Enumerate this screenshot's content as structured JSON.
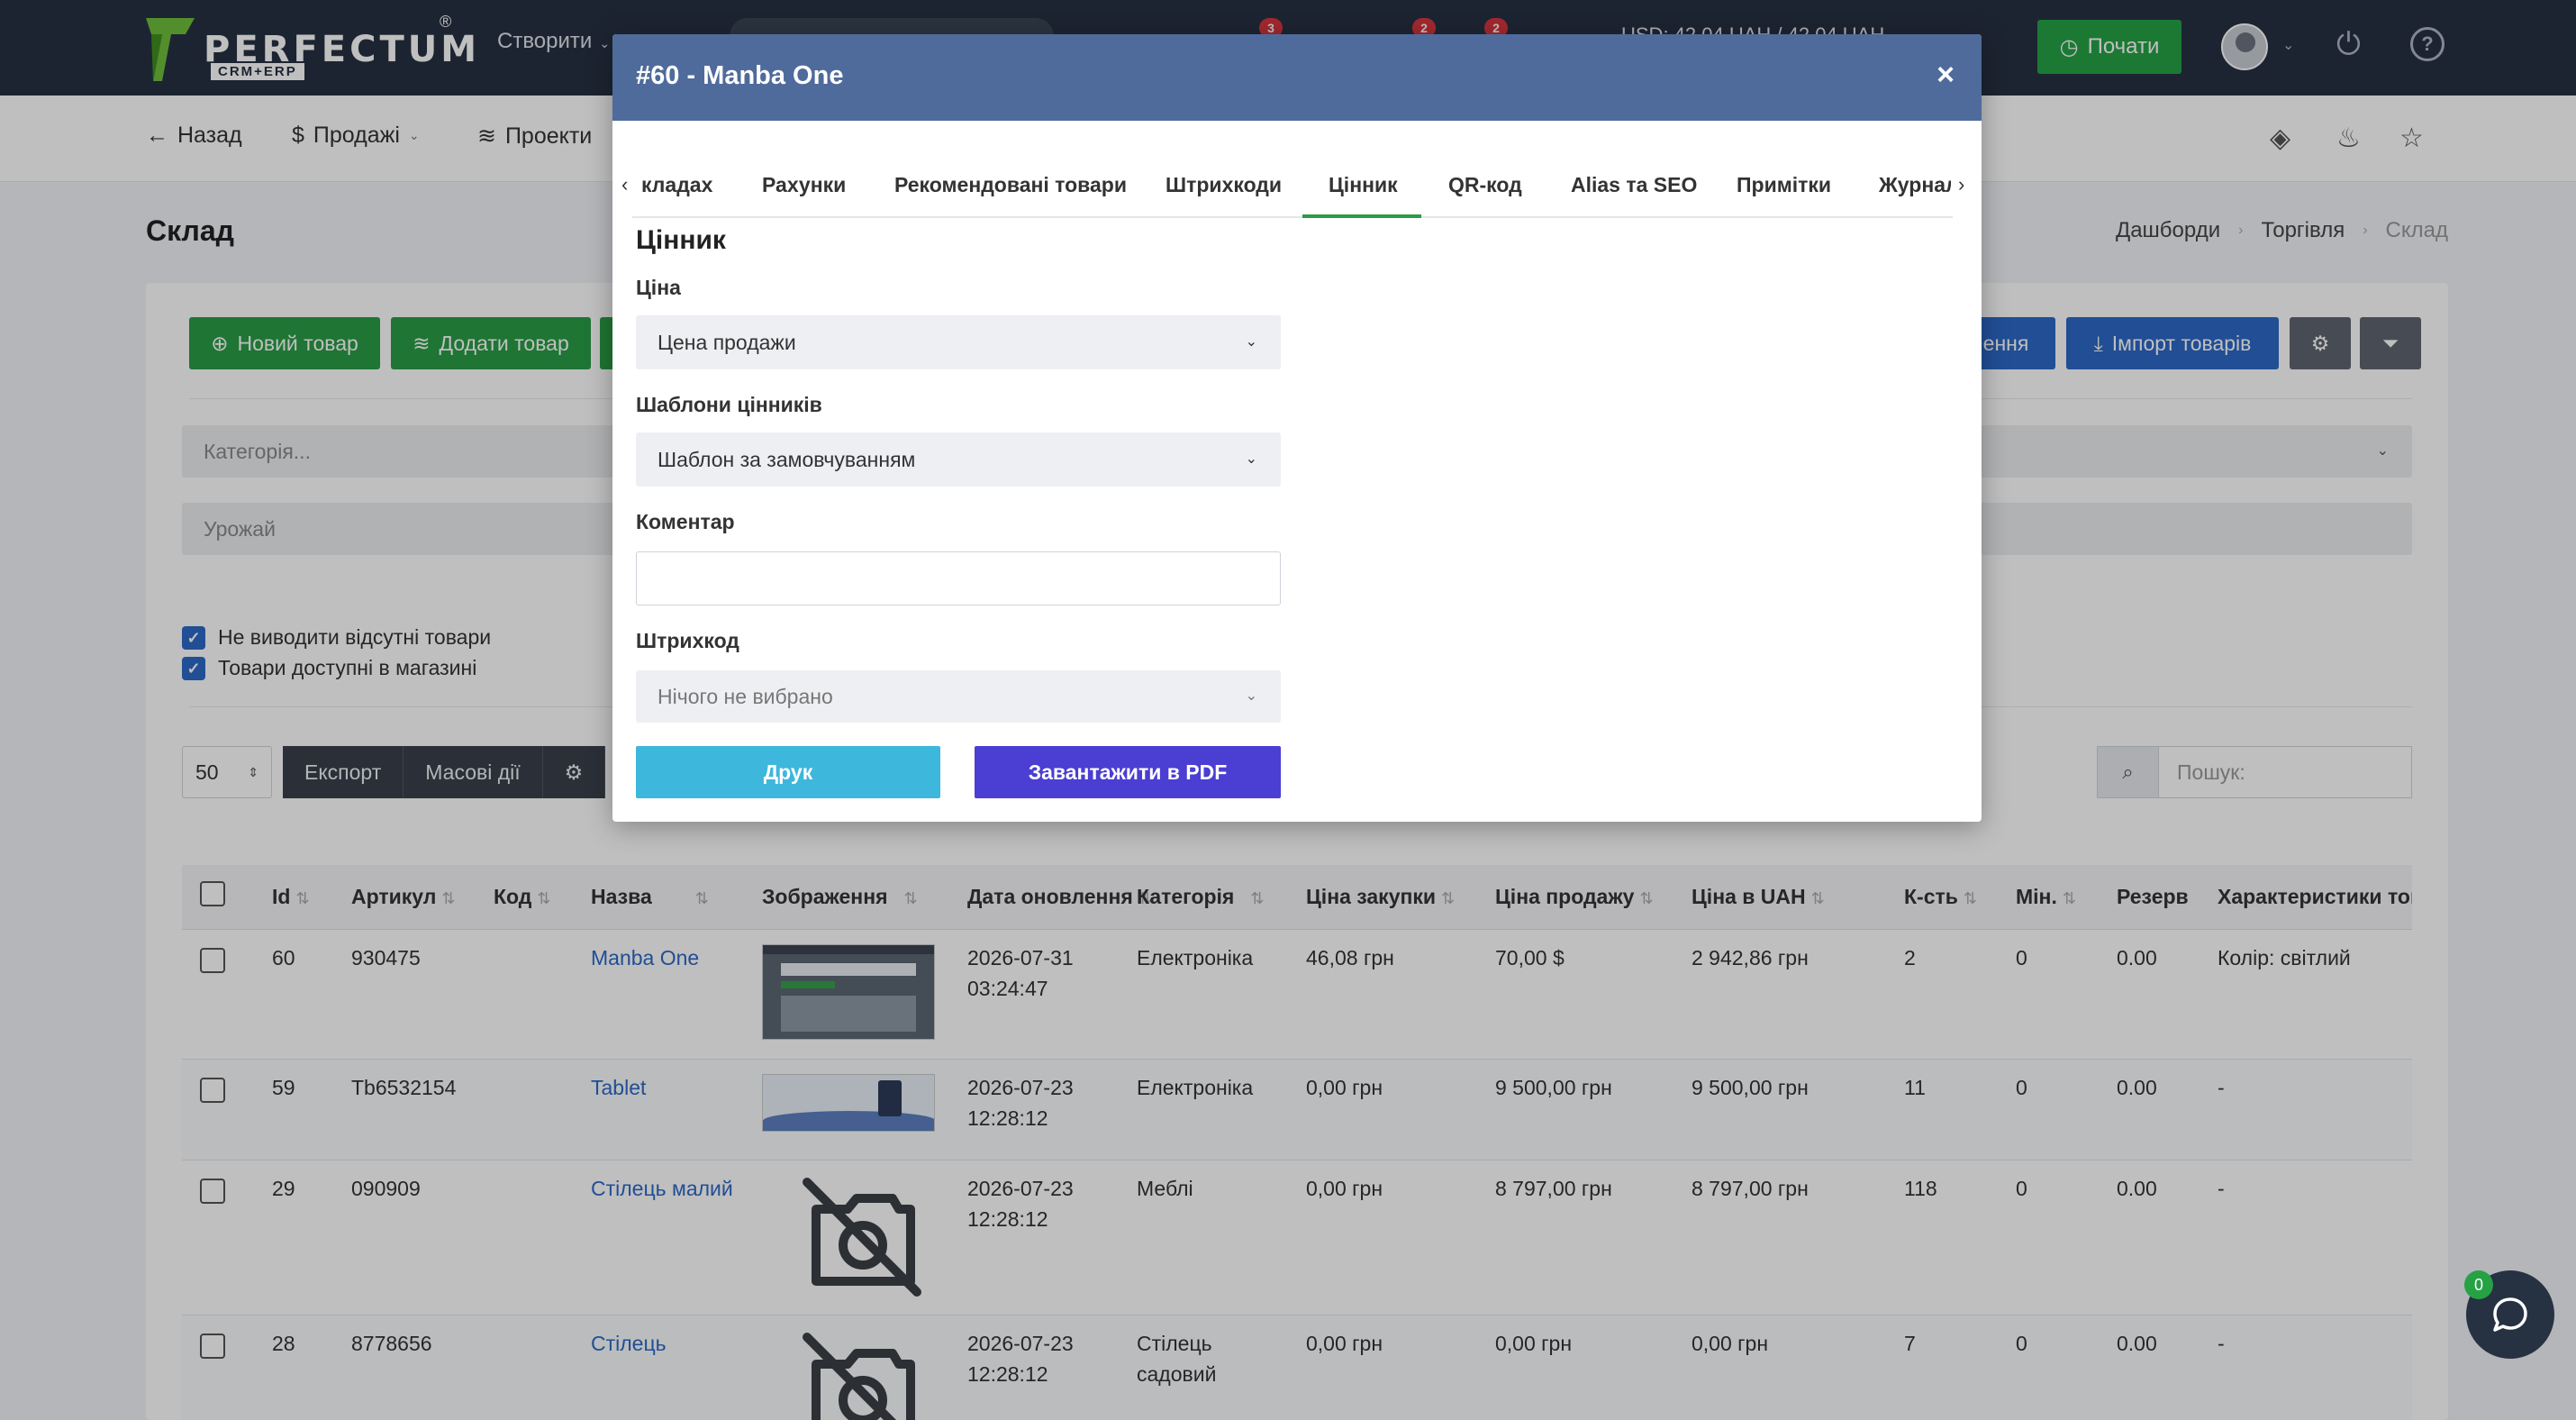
{
  "topbar": {
    "logo_text": "PERFECTUM",
    "logo_sub": "CRM+ERP",
    "logo_reg": "®",
    "create_label": "Створити",
    "badge_1": "3",
    "badge_2": "2",
    "badge_3": "2",
    "currency": "USD: 42,04 UAH / 42,04 UAH",
    "start_label": "Почати"
  },
  "subnav": {
    "back": "Назад",
    "sales": "Продажі",
    "projects": "Проекти"
  },
  "page": {
    "title": "Склад",
    "breadcrumb": [
      "Дашборди",
      "Торгівля",
      "Склад"
    ]
  },
  "toolbar": {
    "new_product": "Новий товар",
    "add_product": "Додати товар",
    "partial_btn": "ення",
    "import": "Імпорт товарів"
  },
  "filters": {
    "category_placeholder": "Категорія...",
    "harvest_placeholder": "Урожай",
    "hide_missing": "Не виводити відсутні товари",
    "available_in_store": "Товари доступні в магазині"
  },
  "list_controls": {
    "page_size": "50",
    "export": "Експорт",
    "bulk_actions": "Масові дії",
    "search_placeholder": "Пошук:"
  },
  "table": {
    "headers": [
      "Id",
      "Артикул",
      "Код",
      "Назва",
      "Зображення",
      "Дата оновлення",
      "Категорія",
      "Ціна закупки",
      "Ціна продажу",
      "Ціна в UAH",
      "К-сть",
      "Мін.",
      "Резерв",
      "Характеристики тов"
    ],
    "rows": [
      {
        "id": "60",
        "sku": "930475",
        "code": "",
        "name": "Manba One",
        "date": "2026-07-31",
        "time": "03:24:47",
        "category": "Електроніка",
        "category2": "",
        "buy": "46,08 грн",
        "sell": "70,00 $",
        "uah": "2 942,86 грн",
        "qty": "2",
        "min": "0",
        "reserve": "0.00",
        "specs": "Колір: світлий"
      },
      {
        "id": "59",
        "sku": "Tb6532154",
        "code": "",
        "name": "Tablet",
        "date": "2026-07-23",
        "time": "12:28:12",
        "category": "Електроніка",
        "category2": "",
        "buy": "0,00 грн",
        "sell": "9 500,00 грн",
        "uah": "9 500,00 грн",
        "qty": "11",
        "min": "0",
        "reserve": "0.00",
        "specs": "-"
      },
      {
        "id": "29",
        "sku": "090909",
        "code": "",
        "name": "Стілець малий",
        "date": "2026-07-23",
        "time": "12:28:12",
        "category": "Меблі",
        "category2": "",
        "buy": "0,00 грн",
        "sell": "8 797,00 грн",
        "uah": "8 797,00 грн",
        "qty": "118",
        "min": "0",
        "reserve": "0.00",
        "specs": "-"
      },
      {
        "id": "28",
        "sku": "8778656",
        "code": "",
        "name": "Стілець",
        "date": "2026-07-23",
        "time": "12:28:12",
        "category": "Стілець",
        "category2": "садовий",
        "buy": "0,00 грн",
        "sell": "0,00 грн",
        "uah": "0,00 грн",
        "qty": "7",
        "min": "0",
        "reserve": "0.00",
        "specs": "-"
      }
    ]
  },
  "modal": {
    "title": "#60 - Manba One",
    "close": "×",
    "tabs": [
      "кладах",
      "Рахунки",
      "Рекомендовані товари",
      "Штрихкоди",
      "Цінник",
      "QR-код",
      "Alias та SEO",
      "Примітки",
      "Журнал"
    ],
    "active_tab": "Цінник",
    "section_title": "Цінник",
    "price_label": "Ціна",
    "price_value": "Цена продажи",
    "templates_label": "Шаблони цінників",
    "templates_value": "Шаблон за замовчуванням",
    "comment_label": "Коментар",
    "barcode_label": "Штрихкод",
    "barcode_value": "Нічого не вибрано",
    "print_label": "Друк",
    "pdf_label": "Завантажити в PDF"
  },
  "chat": {
    "badge": "0"
  }
}
